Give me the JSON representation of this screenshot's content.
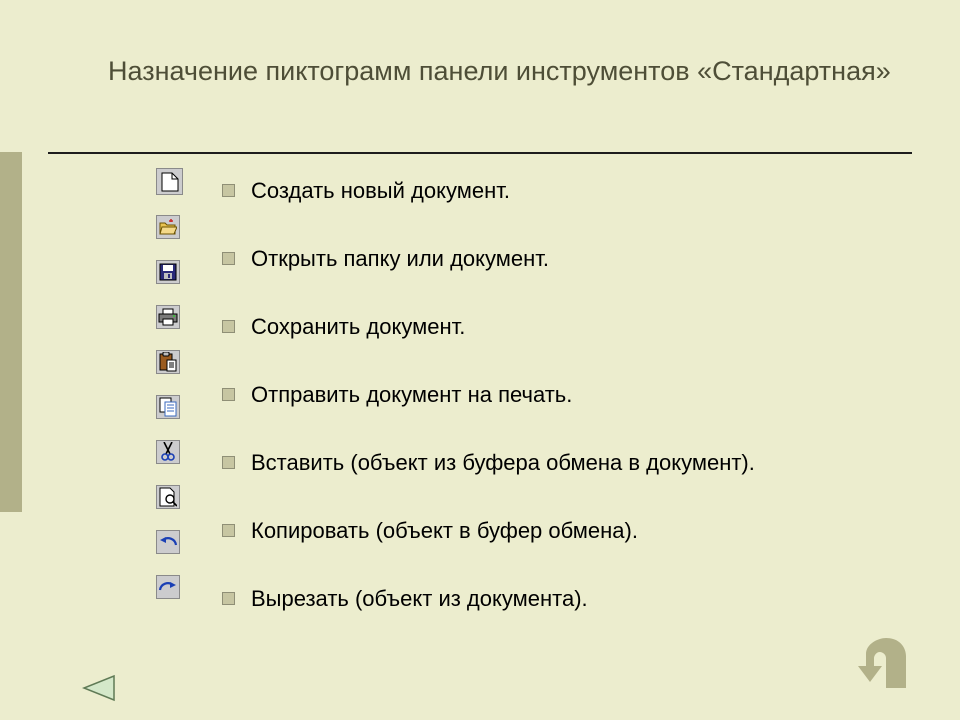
{
  "title": "Назначение пиктограмм панели инструментов «Стандартная»",
  "icons": [
    "document-new",
    "folder-open",
    "save-floppy",
    "print",
    "paste-clipboard",
    "copy",
    "cut-scissors",
    "print-preview",
    "undo",
    "redo"
  ],
  "items": [
    "Создать новый документ.",
    "Открыть папку или документ.",
    "Сохранить документ.",
    "Отправить документ на печать.",
    "Вставить (объект из буфера обмена в документ).",
    "Копировать (объект в буфер обмена).",
    "Вырезать (объект из документа)."
  ],
  "nav": {
    "prev": "previous-slide",
    "back": "back"
  }
}
